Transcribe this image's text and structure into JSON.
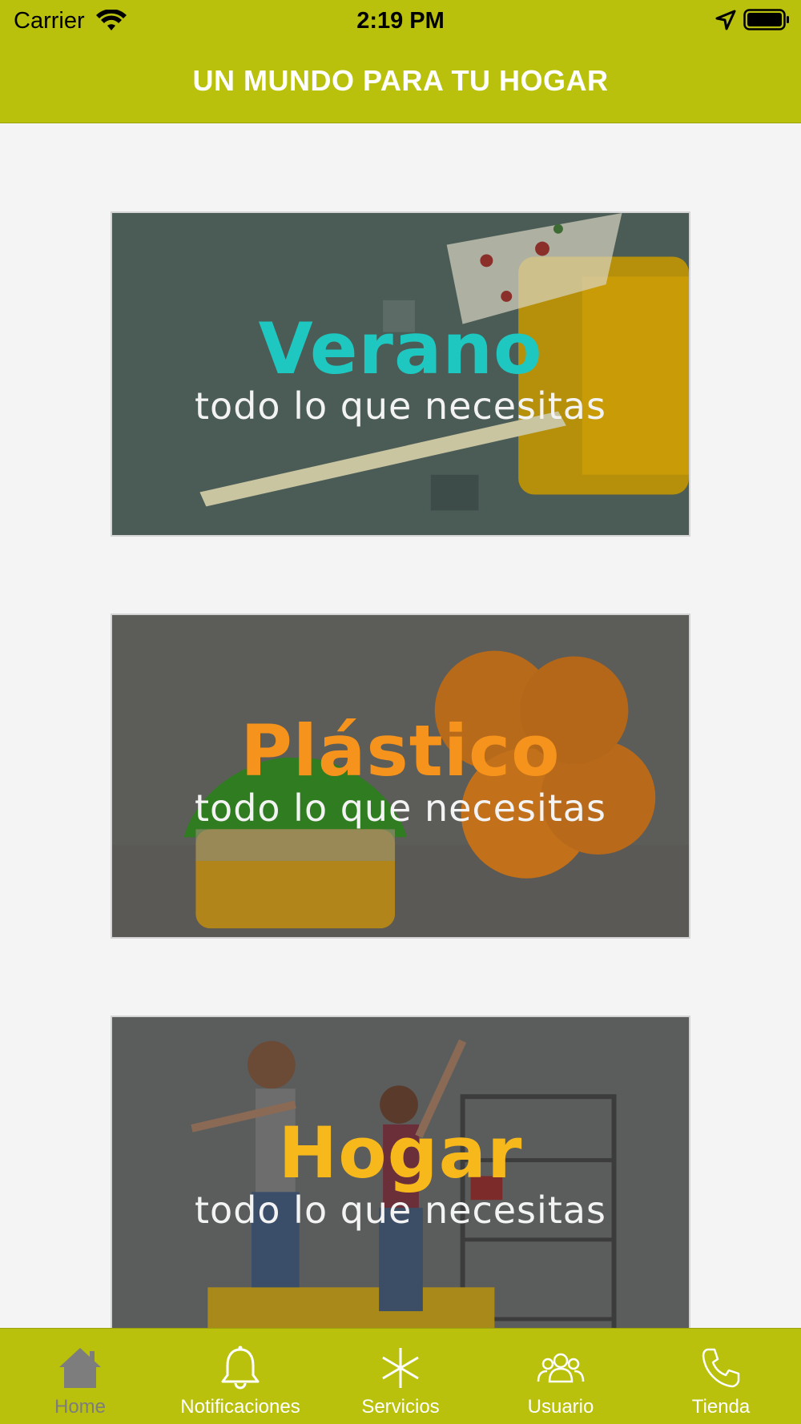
{
  "status_bar": {
    "carrier": "Carrier",
    "time": "2:19 PM",
    "icons": [
      "wifi-icon",
      "location-arrow-icon",
      "battery-icon"
    ]
  },
  "header": {
    "title": "UN MUNDO PARA TU HOGAR"
  },
  "banners": [
    {
      "heading": "Verano",
      "subtitle": "todo lo que necesitas",
      "heading_color": "#1ec8c0"
    },
    {
      "heading": "Plástico",
      "subtitle": "todo lo que necesitas",
      "heading_color": "#f6931c"
    },
    {
      "heading": "Hogar",
      "subtitle": "todo lo que necesitas",
      "heading_color": "#f7b81b"
    }
  ],
  "tabbar": {
    "items": [
      {
        "label": "Home",
        "icon": "home-icon",
        "active": true
      },
      {
        "label": "Notificaciones",
        "icon": "bell-icon",
        "active": false
      },
      {
        "label": "Servicios",
        "icon": "asterisk-icon",
        "active": false
      },
      {
        "label": "Usuario",
        "icon": "users-icon",
        "active": false
      },
      {
        "label": "Tienda",
        "icon": "phone-icon",
        "active": false
      }
    ]
  },
  "colors": {
    "brand": "#b9c10d",
    "background": "#f4f4f4",
    "active_tab": "#7d7d7d"
  }
}
